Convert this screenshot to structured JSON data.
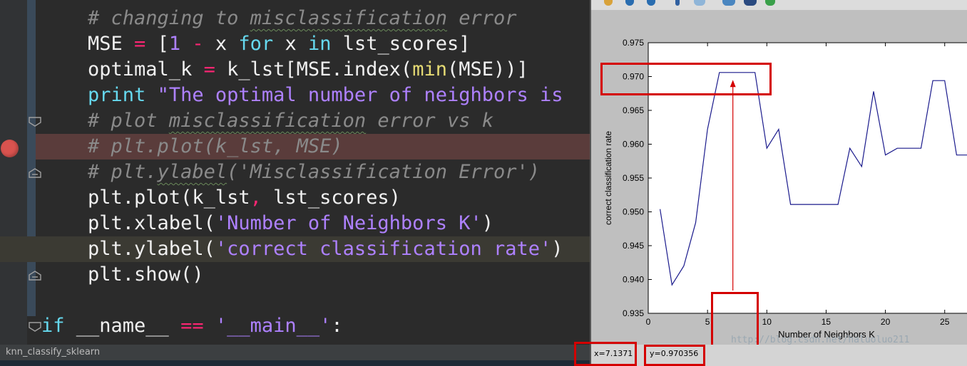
{
  "editor": {
    "lines": [
      {
        "tokens": [
          {
            "t": "    # changing to ",
            "c": "com"
          },
          {
            "t": "misclassification",
            "c": "com wavy"
          },
          {
            "t": " error",
            "c": "com"
          }
        ]
      },
      {
        "tokens": [
          {
            "t": "    MSE ",
            "c": "plain"
          },
          {
            "t": "=",
            "c": "op"
          },
          {
            "t": " [",
            "c": "plain"
          },
          {
            "t": "1",
            "c": "num"
          },
          {
            "t": " ",
            "c": "plain"
          },
          {
            "t": "-",
            "c": "op"
          },
          {
            "t": " x ",
            "c": "plain"
          },
          {
            "t": "for",
            "c": "kw"
          },
          {
            "t": " x ",
            "c": "plain"
          },
          {
            "t": "in",
            "c": "kw"
          },
          {
            "t": " lst_scores]",
            "c": "plain"
          }
        ]
      },
      {
        "tokens": [
          {
            "t": "    optimal_k ",
            "c": "plain"
          },
          {
            "t": "=",
            "c": "op"
          },
          {
            "t": " k_lst[MSE.index(",
            "c": "plain"
          },
          {
            "t": "min",
            "c": "fn"
          },
          {
            "t": "(MSE))]",
            "c": "plain"
          }
        ]
      },
      {
        "tokens": [
          {
            "t": "    ",
            "c": "plain"
          },
          {
            "t": "print",
            "c": "kw"
          },
          {
            "t": " \"The optimal number of neighbors is",
            "c": "str"
          }
        ]
      },
      {
        "tokens": [
          {
            "t": "    # plot ",
            "c": "com"
          },
          {
            "t": "misclassification",
            "c": "com wavy"
          },
          {
            "t": " error vs k",
            "c": "com"
          }
        ]
      },
      {
        "tokens": [
          {
            "t": "    # plt.plot(k_lst, MSE)",
            "c": "com"
          }
        ]
      },
      {
        "tokens": [
          {
            "t": "    # plt.",
            "c": "com"
          },
          {
            "t": "ylabel",
            "c": "com wavy"
          },
          {
            "t": "('Misclassification Error')",
            "c": "com"
          }
        ]
      },
      {
        "tokens": [
          {
            "t": "    plt.plot(k_lst",
            "c": "plain"
          },
          {
            "t": ",",
            "c": "op"
          },
          {
            "t": " lst_scores)",
            "c": "plain"
          }
        ]
      },
      {
        "tokens": [
          {
            "t": "    plt.xlabel(",
            "c": "plain"
          },
          {
            "t": "'Number of Neighbors K'",
            "c": "str"
          },
          {
            "t": ")",
            "c": "plain"
          }
        ]
      },
      {
        "tokens": [
          {
            "t": "    plt.ylabel(",
            "c": "plain"
          },
          {
            "t": "'correct classification rate'",
            "c": "str"
          },
          {
            "t": ")",
            "c": "plain"
          }
        ]
      },
      {
        "tokens": [
          {
            "t": "    plt.show()",
            "c": "plain"
          }
        ]
      },
      {
        "tokens": [
          {
            "t": "",
            "c": "plain"
          }
        ]
      },
      {
        "tokens": [
          {
            "t": "if",
            "c": "kw"
          },
          {
            "t": " __name__ ",
            "c": "plain"
          },
          {
            "t": "==",
            "c": "op"
          },
          {
            "t": " ",
            "c": "plain"
          },
          {
            "t": "'__main__'",
            "c": "str"
          },
          {
            "t": ":",
            "c": "plain"
          }
        ]
      }
    ]
  },
  "status_bar": {
    "run_config": "knn_classify_sklearn"
  },
  "plot_window": {
    "coord_x": "x=7.1371",
    "coord_y": "y=0.970356",
    "watermark": "http://blog.csdn.net/haluoluo211"
  },
  "colors": {
    "line": "#1a1a8c",
    "annotation": "#d40000",
    "breakpoint": "#d9534f"
  },
  "chart_data": {
    "type": "line",
    "xlabel": "Number of Neighbors K",
    "ylabel": "correct classification rate",
    "title": "",
    "xlim": [
      0,
      27
    ],
    "ylim": [
      0.935,
      0.975
    ],
    "xticks": [
      0,
      5,
      10,
      15,
      20,
      25
    ],
    "yticks": [
      0.935,
      0.94,
      0.945,
      0.95,
      0.955,
      0.96,
      0.965,
      0.97,
      0.975
    ],
    "series": [
      {
        "x": [
          1,
          2,
          3,
          4,
          5,
          6,
          7,
          8,
          9,
          10,
          11,
          12,
          13,
          14,
          15,
          16,
          17,
          18,
          19,
          20,
          21,
          22,
          23,
          24,
          25,
          26,
          27
        ],
        "y": [
          0.9504,
          0.9392,
          0.942,
          0.9484,
          0.9622,
          0.9706,
          0.9706,
          0.9706,
          0.9706,
          0.9594,
          0.9622,
          0.9511,
          0.9511,
          0.9511,
          0.9511,
          0.9511,
          0.9594,
          0.9567,
          0.9678,
          0.9584,
          0.9594,
          0.9594,
          0.9594,
          0.9694,
          0.9694,
          0.9584,
          0.9584
        ]
      }
    ]
  }
}
